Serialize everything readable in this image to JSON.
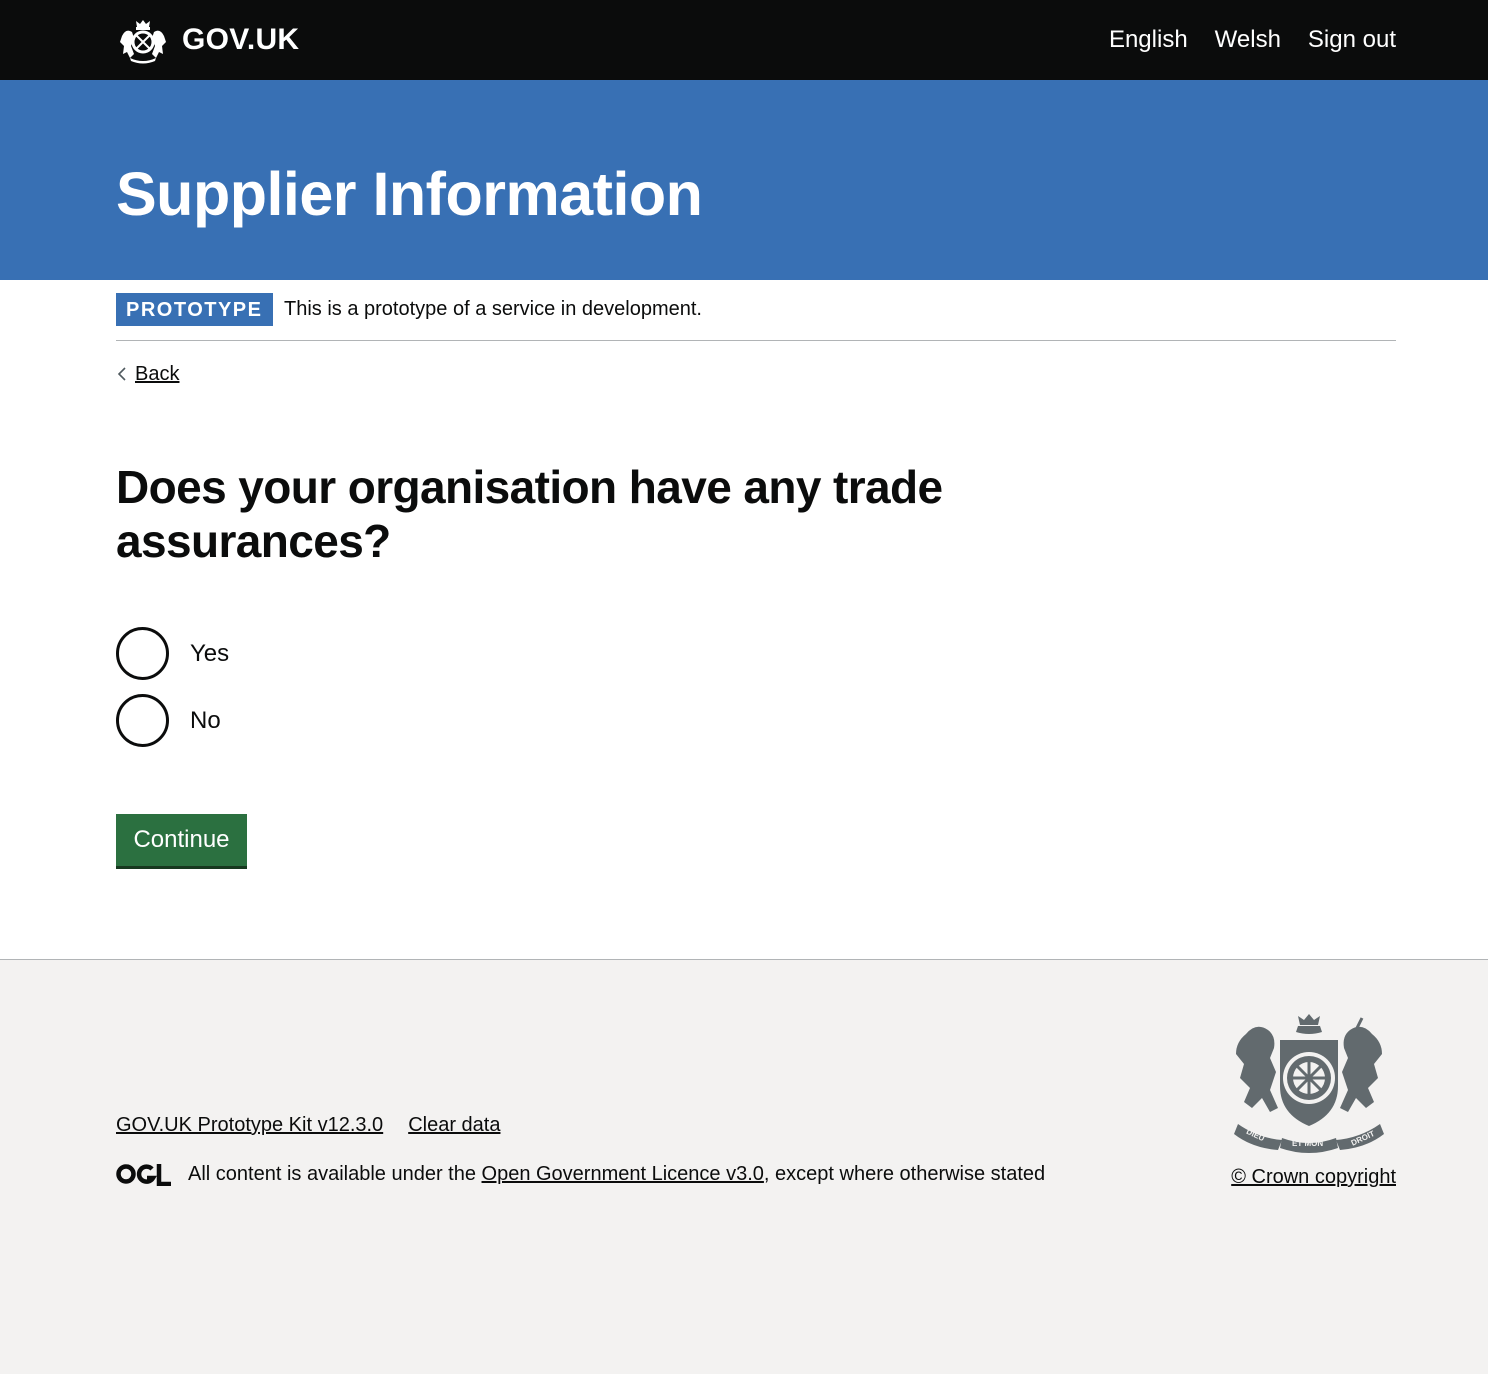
{
  "header": {
    "logo_text": "GOV.UK",
    "nav": [
      "English",
      "Welsh",
      "Sign out"
    ]
  },
  "banner": {
    "service_name": "Supplier Information",
    "color": "#3870b4"
  },
  "phase": {
    "tag": "PROTOTYPE",
    "text": "This is a prototype of a service in development."
  },
  "back": {
    "label": "Back"
  },
  "question": {
    "title": "Does your organisation have any trade assurances?"
  },
  "options": [
    {
      "label": "Yes",
      "selected": false
    },
    {
      "label": "No",
      "selected": false
    }
  ],
  "continue": {
    "label": "Continue",
    "color": "#2b7040"
  },
  "footer": {
    "links": [
      "GOV.UK Prototype Kit v12.3.0",
      "Clear data"
    ],
    "licence_prefix": "All content is available under the ",
    "licence_link": "Open Government Licence v3.0",
    "licence_suffix": ", except where otherwise stated",
    "crown_copyright": "© Crown copyright",
    "crest_mottos": [
      "DIEU",
      "ET MON",
      "DROIT"
    ]
  }
}
